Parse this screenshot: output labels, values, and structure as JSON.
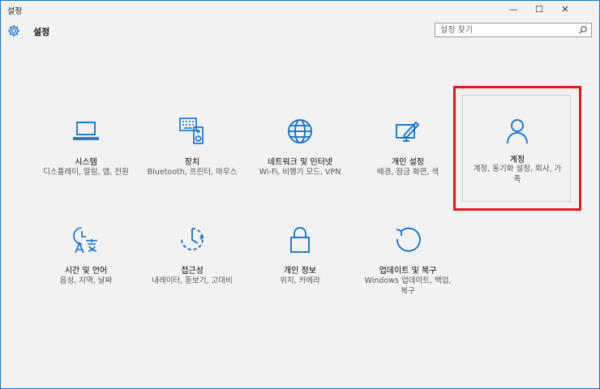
{
  "window": {
    "title": "설정",
    "minimize": "—",
    "maximize": "☐",
    "close": "✕"
  },
  "header": {
    "title": "설정",
    "gear_icon": "gear-icon"
  },
  "search": {
    "placeholder": "설정 찾기",
    "icon": "search-icon"
  },
  "accent_color": "#0a6ed1",
  "highlight_color": "#e8141e",
  "tiles": [
    {
      "label": "시스템",
      "desc": "디스플레이, 알림, 앱, 전원",
      "icon": "laptop-icon"
    },
    {
      "label": "장치",
      "desc": "Bluetooth, 프린터, 마우스",
      "icon": "keyboard-speaker-icon"
    },
    {
      "label": "네트워크 및 인터넷",
      "desc": "Wi-Fi, 비행기 모드, VPN",
      "icon": "globe-icon"
    },
    {
      "label": "개인 설정",
      "desc": "배경, 잠금 화면, 색",
      "icon": "paint-screen-icon"
    },
    {
      "label": "계정",
      "desc": "계정, 동기화 설정, 회사, 가족",
      "icon": "person-icon"
    },
    {
      "label": "시간 및 언어",
      "desc": "음성, 지역, 날짜",
      "icon": "time-language-icon"
    },
    {
      "label": "접근성",
      "desc": "내레이터, 돋보기, 고대비",
      "icon": "accessibility-icon"
    },
    {
      "label": "개인 정보",
      "desc": "위치, 카메라",
      "icon": "lock-icon"
    },
    {
      "label": "업데이트 및 복구",
      "desc": "Windows 업데이트, 백업, 복구",
      "icon": "refresh-icon"
    }
  ]
}
